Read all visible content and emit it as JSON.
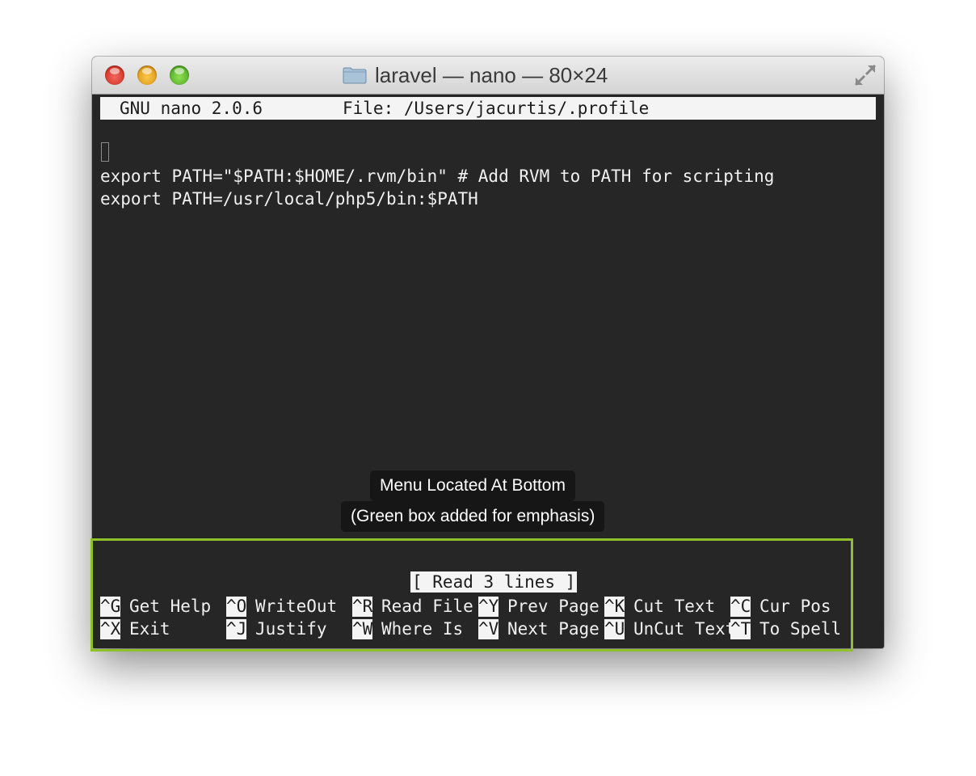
{
  "window": {
    "title": "laravel — nano — 80×24",
    "icons": {
      "close": "close-button-red",
      "minimize": "minimize-button-yellow",
      "zoom": "zoom-button-green",
      "folder": "folder-icon",
      "fullscreen": "fullscreen-arrows-icon"
    }
  },
  "nano": {
    "version": "GNU nano 2.0.6",
    "file": "File: /Users/jacurtis/.profile",
    "lines": [
      "export PATH=\"$PATH:$HOME/.rvm/bin\" # Add RVM to PATH for scripting",
      "export PATH=/usr/local/php5/bin:$PATH"
    ],
    "status": "[ Read 3 lines ]",
    "shortcuts_row1": [
      {
        "key": "^G",
        "label": "Get Help"
      },
      {
        "key": "^O",
        "label": "WriteOut"
      },
      {
        "key": "^R",
        "label": "Read File"
      },
      {
        "key": "^Y",
        "label": "Prev Page"
      },
      {
        "key": "^K",
        "label": "Cut Text"
      },
      {
        "key": "^C",
        "label": "Cur Pos"
      }
    ],
    "shortcuts_row2": [
      {
        "key": "^X",
        "label": "Exit"
      },
      {
        "key": "^J",
        "label": "Justify"
      },
      {
        "key": "^W",
        "label": "Where Is"
      },
      {
        "key": "^V",
        "label": "Next Page"
      },
      {
        "key": "^U",
        "label": "UnCut Text"
      },
      {
        "key": "^T",
        "label": "To Spell"
      }
    ]
  },
  "annotation": {
    "line1": "Menu Located At Bottom",
    "line2": "(Green box added for emphasis)",
    "highlight_color": "#8fbf2b"
  },
  "colors": {
    "terminal_bg": "#262626",
    "terminal_fg": "#f0f0f0",
    "inverse_bg": "#f4f4f4"
  }
}
